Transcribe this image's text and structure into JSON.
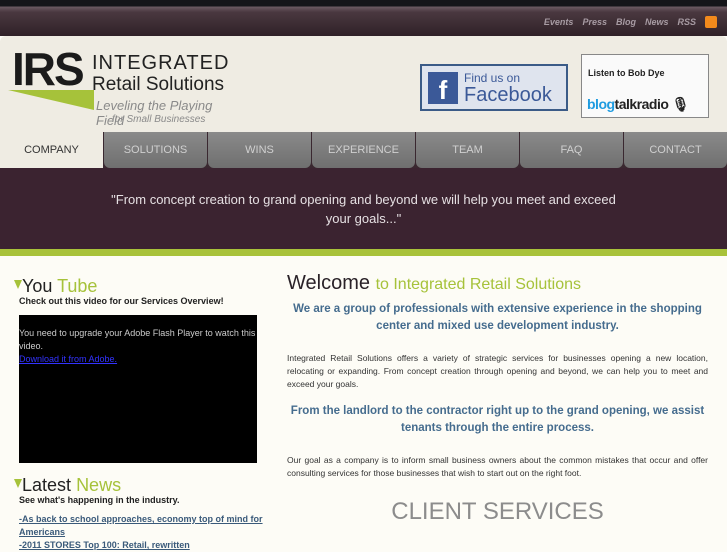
{
  "top_links": [
    "Events",
    "Press",
    "Blog",
    "News",
    "RSS"
  ],
  "logo": {
    "mark": "IRS",
    "line1": "INTEGRATED",
    "line2": "Retail Solutions",
    "tagline1": "Leveling the Playing Field",
    "tagline2": "for Small Businesses"
  },
  "facebook": {
    "line1": "Find us on",
    "line2": "Facebook"
  },
  "blogtalk": {
    "label": "Listen to Bob Dye",
    "brand_blue": "blog",
    "brand_dark": "talkradio"
  },
  "nav": [
    "COMPANY",
    "SOLUTIONS",
    "WINS",
    "EXPERIENCE",
    "TEAM",
    "FAQ",
    "CONTACT"
  ],
  "quote": "\"From concept creation to grand opening and beyond we will help you meet and exceed your goals...\"",
  "youtube": {
    "title_a": "You",
    "title_b": "Tube",
    "subtitle": "Check out this video for our Services Overview!",
    "flash_msg": "You need to upgrade your Adobe Flash Player to watch this video.",
    "flash_link": "Download it from Adobe."
  },
  "news": {
    "title_a": "Latest",
    "title_b": "News",
    "subtitle": "See what's happening in the industry.",
    "items": [
      "-As back to school approaches, economy top of mind for Americans",
      "-2011 STORES Top 100: Retail, rewritten"
    ]
  },
  "main": {
    "welcome": "Welcome",
    "welcome_sub": "to Integrated Retail Solutions",
    "lead1": "We are a group of professionals with extensive experience in the shopping center and mixed use development industry.",
    "p1": "Integrated Retail Solutions offers a variety of strategic services for businesses opening a new location, relocating or expanding. From concept creation through opening and beyond, we can help you to meet and exceed your goals.",
    "lead2": "From the landlord to the contractor right up to the grand opening, we assist tenants through the entire process.",
    "p2": "Our goal as a company is to inform small business owners about the common mistakes that occur and offer consulting services for those businesses that wish to start out on the right foot.",
    "client_services": "CLIENT SERVICES"
  }
}
